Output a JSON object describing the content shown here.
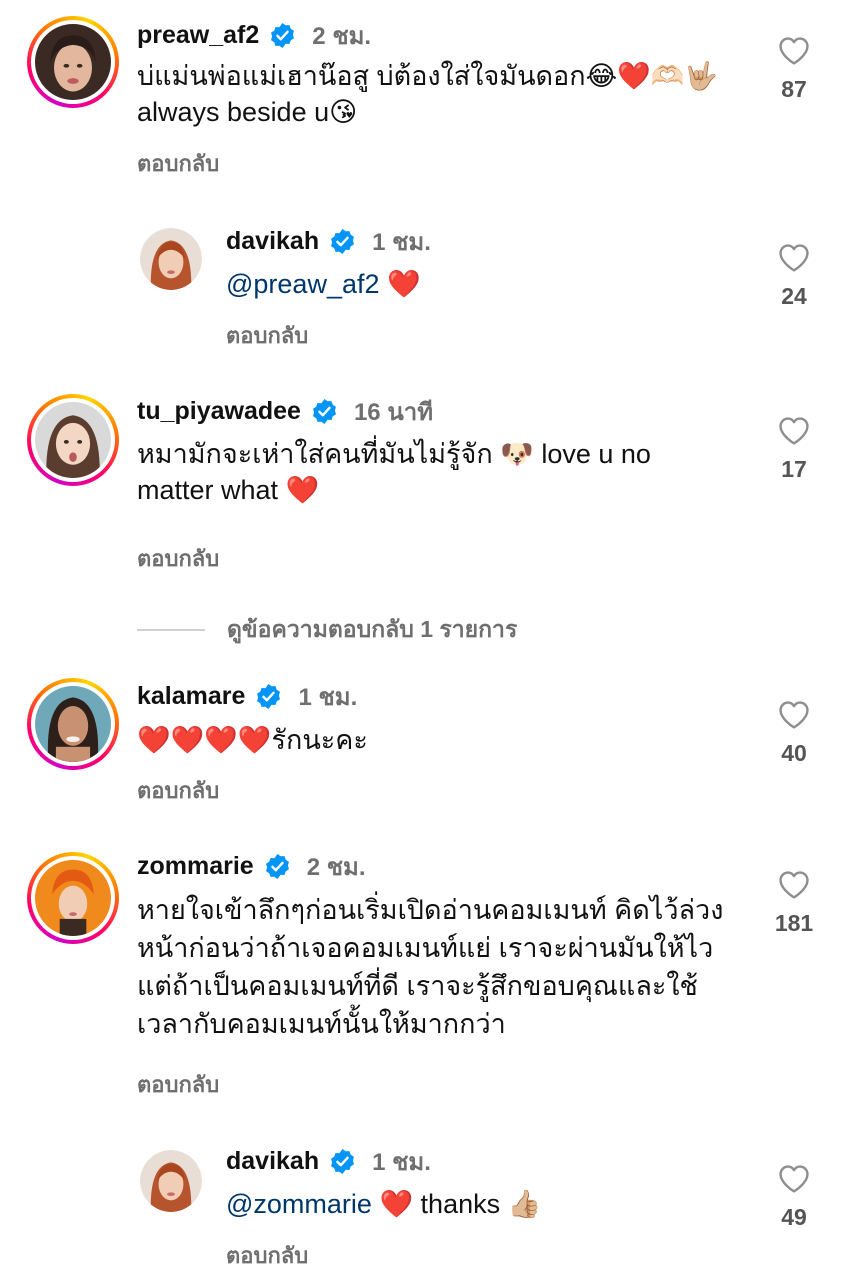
{
  "reply_label": "ตอบกลับ",
  "view_replies": "ดูข้อความตอบกลับ 1 รายการ",
  "comments": [
    {
      "username": "preaw_af2",
      "time": "2 ชม.",
      "text_line1": "บ่แม่นพ่อแม่เฮาน๊อสู บ่ต้องใส่ใจมันดอก😂❤️🫶🏻🤟🏼",
      "text_line2": "always beside u😘",
      "likes": "87"
    },
    {
      "username": "davikah",
      "time": "1 ชม.",
      "mention": "@preaw_af2",
      "text_after": " ❤️",
      "likes": "24"
    },
    {
      "username": "tu_piyawadee",
      "time": "16 นาที",
      "text_line1": "หมามักจะเห่าใส่คนที่มันไม่รู้จัก 🐶 love u no",
      "text_line2": "matter what ❤️",
      "likes": "17"
    },
    {
      "username": "kalamare",
      "time": "1 ชม.",
      "text_line1": "❤️❤️❤️❤️รักนะคะ",
      "likes": "40"
    },
    {
      "username": "zommarie",
      "time": "2 ชม.",
      "text_line1": "หายใจเข้าลึกๆก่อนเริ่มเปิดอ่านคอมเมนท์ คิดไว้ล่วง",
      "text_line2": "หน้าก่อนว่าถ้าเจอคอมเมนท์แย่ เราจะผ่านมันให้ไว",
      "text_line3": "แต่ถ้าเป็นคอมเมนท์ที่ดี เราจะรู้สึกขอบคุณและใช้",
      "text_line4": "เวลากับคอมเมนท์นั้นให้มากกว่า",
      "likes": "181"
    },
    {
      "username": "davikah",
      "time": "1 ชม.",
      "mention": "@zommarie",
      "text_after": " ❤️ thanks 👍🏼",
      "likes": "49"
    }
  ],
  "colors": {
    "verified_blue": "#0095f6",
    "mention": "#00376b",
    "secondary_text": "#6f6f6f",
    "heart_red": "#ed1c3c"
  }
}
